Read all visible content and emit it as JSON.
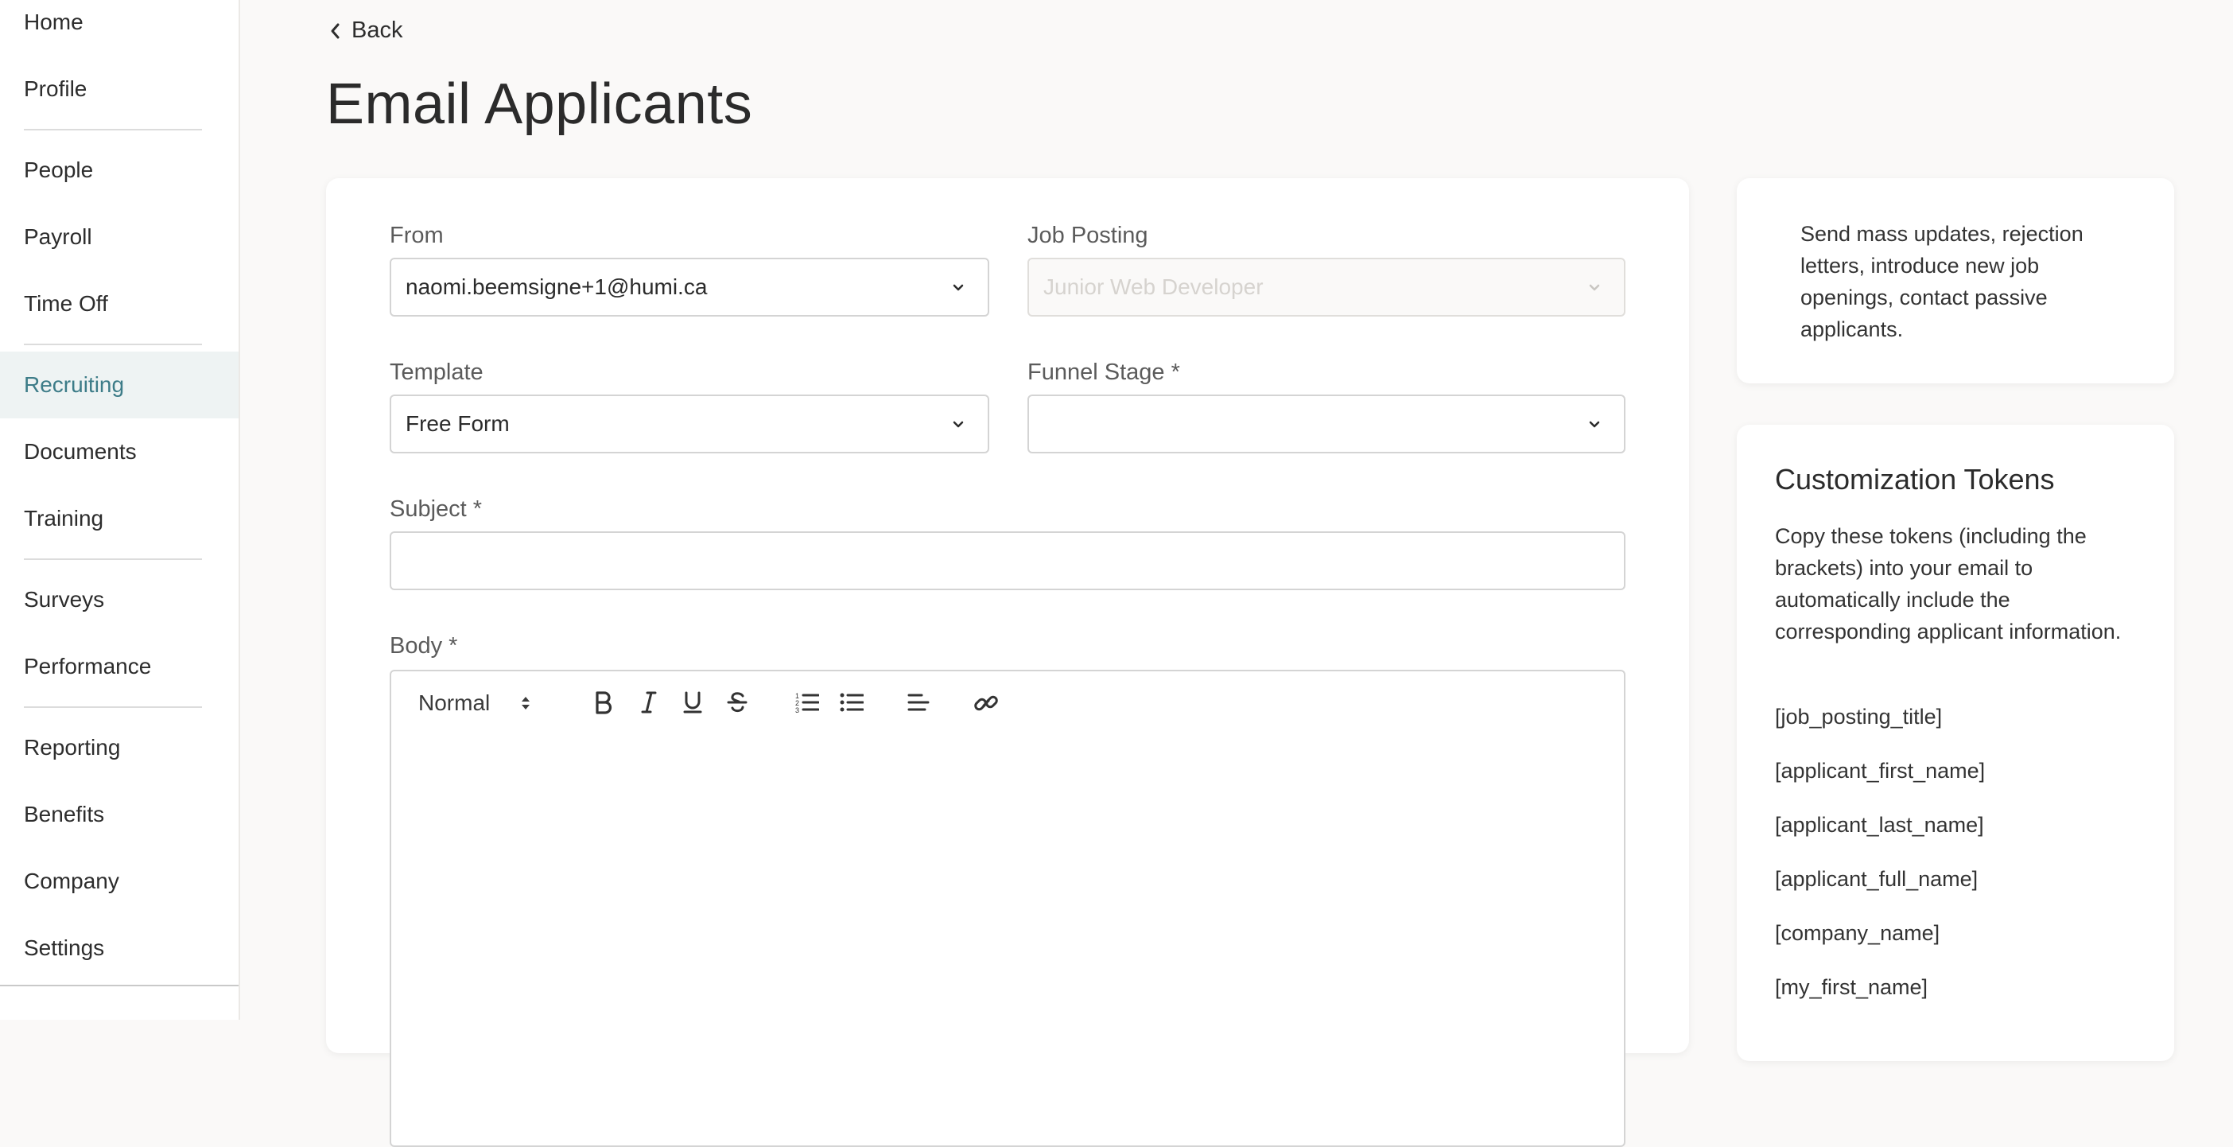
{
  "sidebar": {
    "items": [
      {
        "label": "Home"
      },
      {
        "label": "Profile"
      },
      {
        "label": "People"
      },
      {
        "label": "Payroll"
      },
      {
        "label": "Time Off"
      },
      {
        "label": "Recruiting",
        "active": true
      },
      {
        "label": "Documents"
      },
      {
        "label": "Training"
      },
      {
        "label": "Surveys"
      },
      {
        "label": "Performance"
      },
      {
        "label": "Reporting"
      },
      {
        "label": "Benefits"
      },
      {
        "label": "Company"
      },
      {
        "label": "Settings"
      }
    ]
  },
  "header": {
    "back_label": "Back",
    "title": "Email Applicants"
  },
  "form": {
    "from": {
      "label": "From",
      "value": "naomi.beemsigne+1@humi.ca"
    },
    "job_posting": {
      "label": "Job Posting",
      "value": "Junior Web Developer",
      "disabled": true
    },
    "template": {
      "label": "Template",
      "value": "Free Form"
    },
    "funnel_stage": {
      "label": "Funnel Stage *",
      "value": ""
    },
    "subject": {
      "label": "Subject *",
      "value": ""
    },
    "body": {
      "label": "Body *",
      "value": ""
    },
    "toolbar": {
      "format_label": "Normal",
      "buttons": [
        "bold-icon",
        "italic-icon",
        "underline-icon",
        "strikethrough-icon",
        "ordered-list-icon",
        "bullet-list-icon",
        "align-left-icon",
        "link-icon"
      ]
    }
  },
  "info": {
    "text": "Send mass updates, rejection letters, introduce new job openings, contact passive applicants."
  },
  "tokens": {
    "title": "Customization Tokens",
    "description": "Copy these tokens (including the brackets) into your email to automatically include the corresponding applicant information.",
    "items": [
      "[job_posting_title]",
      "[applicant_first_name]",
      "[applicant_last_name]",
      "[applicant_full_name]",
      "[company_name]",
      "[my_first_name]"
    ]
  },
  "colors": {
    "accent": "#3d7c88",
    "active_bg": "#eef3f3",
    "page_bg": "#faf9f8"
  }
}
